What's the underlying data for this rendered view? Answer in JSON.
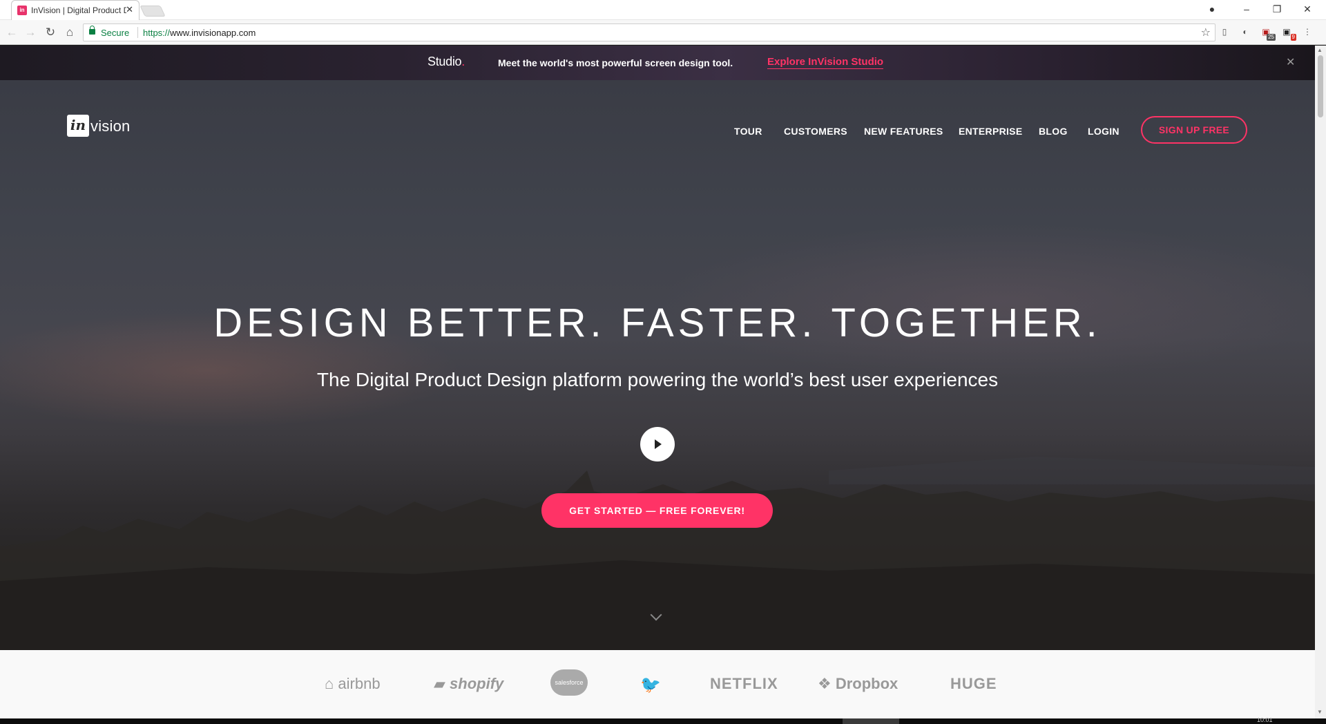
{
  "browser": {
    "tab_title": "InVision | Digital Product Design, Workflow & Collaboration",
    "tab_close": "✕",
    "favicon_text": "in",
    "secure_label": "Secure",
    "url_scheme": "https://",
    "url_rest": "www.invisionapp.com",
    "ext_badges": [
      "25",
      "9"
    ],
    "window_controls": {
      "minimize": "–",
      "restore": "❐",
      "close": "✕"
    }
  },
  "promo": {
    "logo_text": "Studio",
    "logo_dot": ".",
    "message": "Meet the world's most powerful screen design tool.",
    "link_label": "Explore InVision Studio",
    "close": "✕"
  },
  "header": {
    "logo_in": "in",
    "logo_vision": "vision",
    "nav": [
      "TOUR",
      "CUSTOMERS",
      "NEW FEATURES",
      "ENTERPRISE",
      "BLOG",
      "LOGIN"
    ],
    "signup_label": "SIGN UP FREE"
  },
  "hero": {
    "headline": "DESIGN BETTER. FASTER. TOGETHER.",
    "subhead": "The Digital Product Design platform powering the world’s best user experiences",
    "cta_label": "GET STARTED — FREE FOREVER!"
  },
  "customers": [
    "airbnb",
    "shopify",
    "salesforce",
    "twitter",
    "NETFLIX",
    "Dropbox",
    "HUGE"
  ],
  "taskbar": {
    "clock": "10:01"
  },
  "colors": {
    "accent": "#ff3366",
    "secure_green": "#0b8043"
  }
}
